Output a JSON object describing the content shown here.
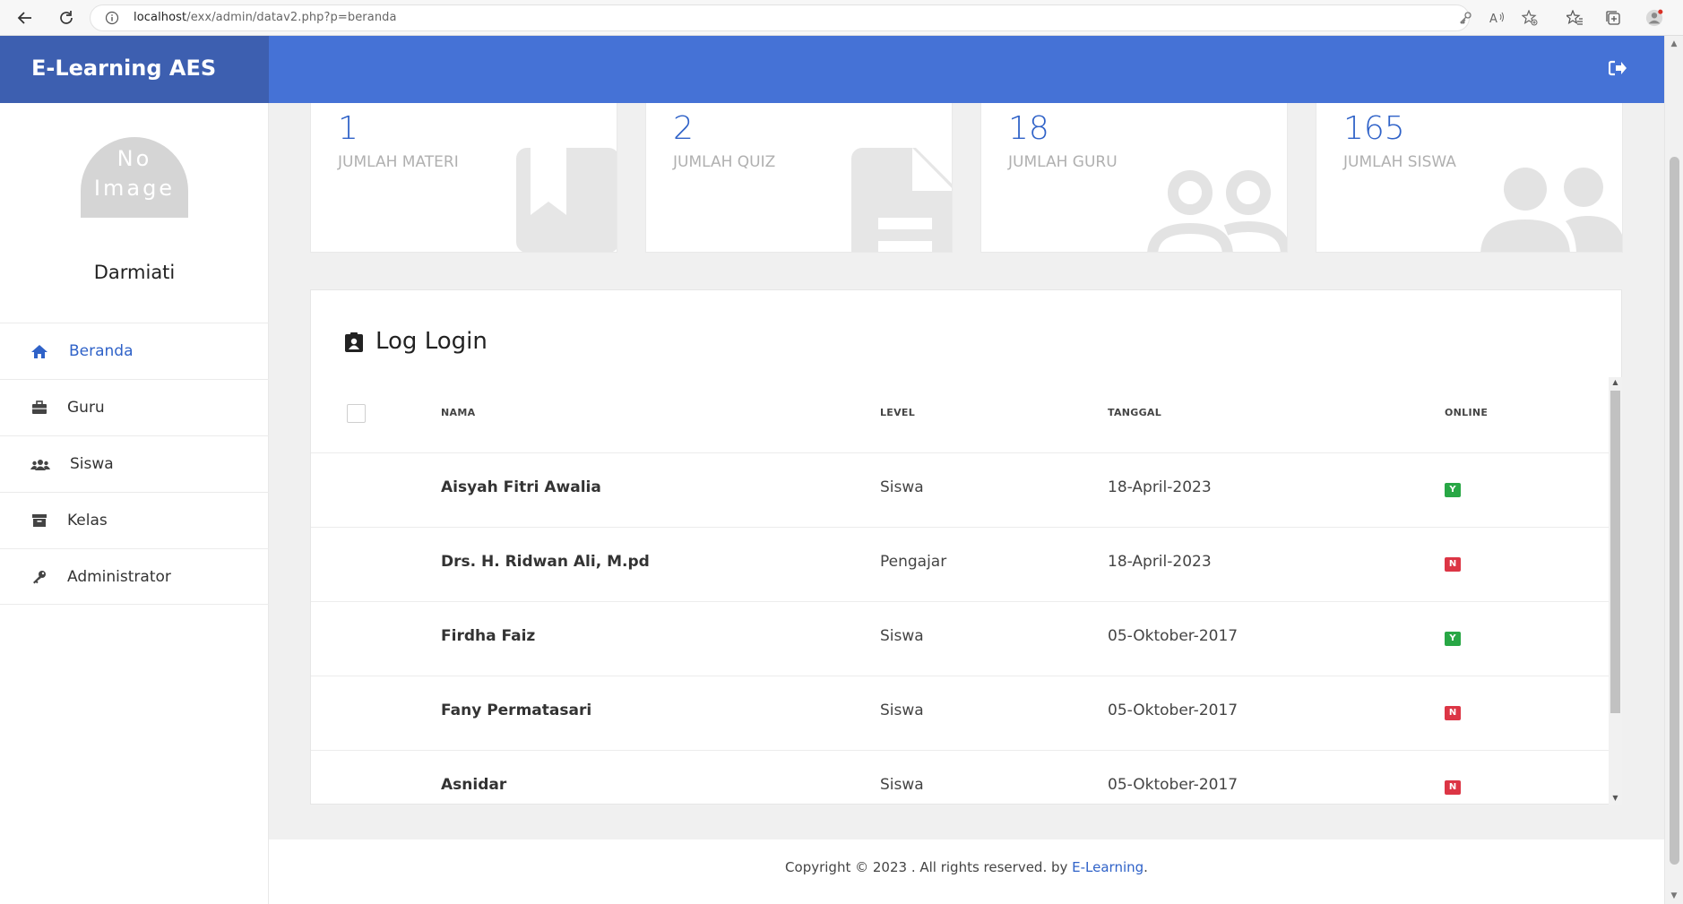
{
  "browser": {
    "url_host": "localhost",
    "url_path": "/exx/admin/datav2.php?p=beranda"
  },
  "header": {
    "brand": "E-Learning AES",
    "logout_icon": "sign-out-icon"
  },
  "sidebar": {
    "avatar_line1": "No",
    "avatar_line2": "Image",
    "username": "Darmiati",
    "items": [
      {
        "label": "Beranda",
        "icon": "home-icon",
        "active": true
      },
      {
        "label": "Guru",
        "icon": "briefcase-icon",
        "active": false
      },
      {
        "label": "Siswa",
        "icon": "users-icon",
        "active": false
      },
      {
        "label": "Kelas",
        "icon": "archive-icon",
        "active": false
      },
      {
        "label": "Administrator",
        "icon": "key-icon",
        "active": false
      }
    ]
  },
  "stats": [
    {
      "value": "1",
      "label": "JUMLAH MATERI",
      "icon": "book-icon"
    },
    {
      "value": "2",
      "label": "JUMLAH QUIZ",
      "icon": "file-icon"
    },
    {
      "value": "18",
      "label": "JUMLAH GURU",
      "icon": "user-friends-outline-icon"
    },
    {
      "value": "165",
      "label": "JUMLAH SISWA",
      "icon": "user-friends-icon"
    }
  ],
  "log": {
    "title": "Log Login",
    "columns": [
      "NAMA",
      "LEVEL",
      "TANGGAL",
      "ONLINE"
    ],
    "rows": [
      {
        "nama": "Aisyah Fitri Awalia",
        "level": "Siswa",
        "tanggal": "18-April-2023",
        "online": "Y"
      },
      {
        "nama": "Drs. H. Ridwan Ali, M.pd",
        "level": "Pengajar",
        "tanggal": "18-April-2023",
        "online": "N"
      },
      {
        "nama": "Firdha Faiz",
        "level": "Siswa",
        "tanggal": "05-Oktober-2017",
        "online": "Y"
      },
      {
        "nama": "Fany Permatasari",
        "level": "Siswa",
        "tanggal": "05-Oktober-2017",
        "online": "N"
      },
      {
        "nama": "Asnidar",
        "level": "Siswa",
        "tanggal": "05-Oktober-2017",
        "online": "N"
      }
    ]
  },
  "footer": {
    "text": "Copyright © 2023 . All rights reserved. by ",
    "link": "E-Learning",
    "end": "."
  },
  "colors": {
    "brand": "#3d5fb0",
    "topbar": "#4572d6",
    "accent": "#2f62c8",
    "online_yes": "#28a745",
    "online_no": "#dc3545"
  }
}
